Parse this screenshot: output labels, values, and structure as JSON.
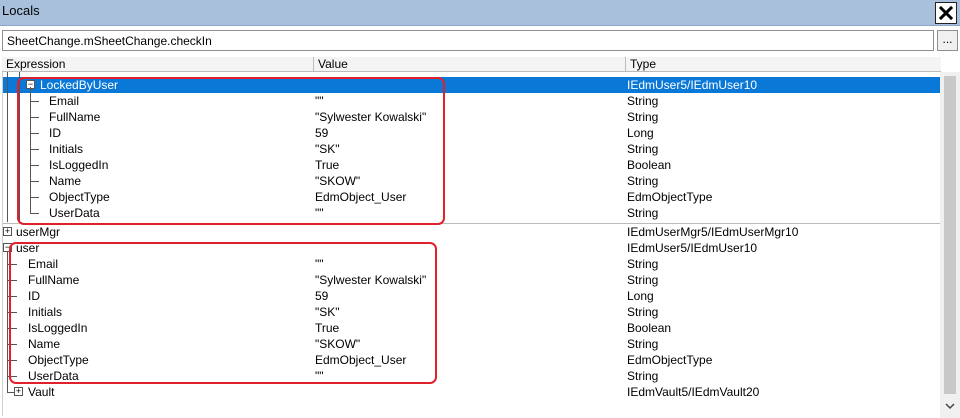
{
  "window": {
    "title": "Locals"
  },
  "context": {
    "value": "SheetChange.mSheetChange.checkIn",
    "button_label": "..."
  },
  "columns": {
    "expression": "Expression",
    "value": "Value",
    "type": "Type"
  },
  "rows": [
    {
      "expr": "LockedByUser",
      "value": "",
      "type": "IEdmUser5/IEdmUser10",
      "node": "minus",
      "selected": true
    },
    {
      "expr": "Email",
      "value": "\"\"",
      "type": "String"
    },
    {
      "expr": "FullName",
      "value": "\"Sylwester Kowalski\"",
      "type": "String"
    },
    {
      "expr": "ID",
      "value": "59",
      "type": "Long"
    },
    {
      "expr": "Initials",
      "value": "\"SK\"",
      "type": "String"
    },
    {
      "expr": "IsLoggedIn",
      "value": "True",
      "type": "Boolean"
    },
    {
      "expr": "Name",
      "value": "\"SKOW\"",
      "type": "String"
    },
    {
      "expr": "ObjectType",
      "value": "EdmObject_User",
      "type": "EdmObjectType"
    },
    {
      "expr": "UserData",
      "value": "\"\"",
      "type": "String"
    },
    {
      "expr": "userMgr",
      "value": "",
      "type": "IEdmUserMgr5/IEdmUserMgr10",
      "node": "plus"
    },
    {
      "expr": "user",
      "value": "",
      "type": "IEdmUser5/IEdmUser10",
      "node": "minus"
    },
    {
      "expr": "Email",
      "value": "\"\"",
      "type": "String"
    },
    {
      "expr": "FullName",
      "value": "\"Sylwester Kowalski\"",
      "type": "String"
    },
    {
      "expr": "ID",
      "value": "59",
      "type": "Long"
    },
    {
      "expr": "Initials",
      "value": "\"SK\"",
      "type": "String"
    },
    {
      "expr": "IsLoggedIn",
      "value": "True",
      "type": "Boolean"
    },
    {
      "expr": "Name",
      "value": "\"SKOW\"",
      "type": "String"
    },
    {
      "expr": "ObjectType",
      "value": "EdmObject_User",
      "type": "EdmObjectType"
    },
    {
      "expr": "UserData",
      "value": "\"\"",
      "type": "String"
    },
    {
      "expr": "Vault",
      "value": "",
      "type": "IEdmVault5/IEdmVault20",
      "node": "plus"
    }
  ],
  "colors": {
    "selection": "#0a78d7",
    "highlight_box": "#e0202a",
    "titlebar": "#a8c0dc"
  },
  "icons": {
    "close": "close-icon",
    "expand": "plus-box-icon",
    "collapse": "minus-box-icon",
    "scroll_down": "chevron-down-icon"
  }
}
